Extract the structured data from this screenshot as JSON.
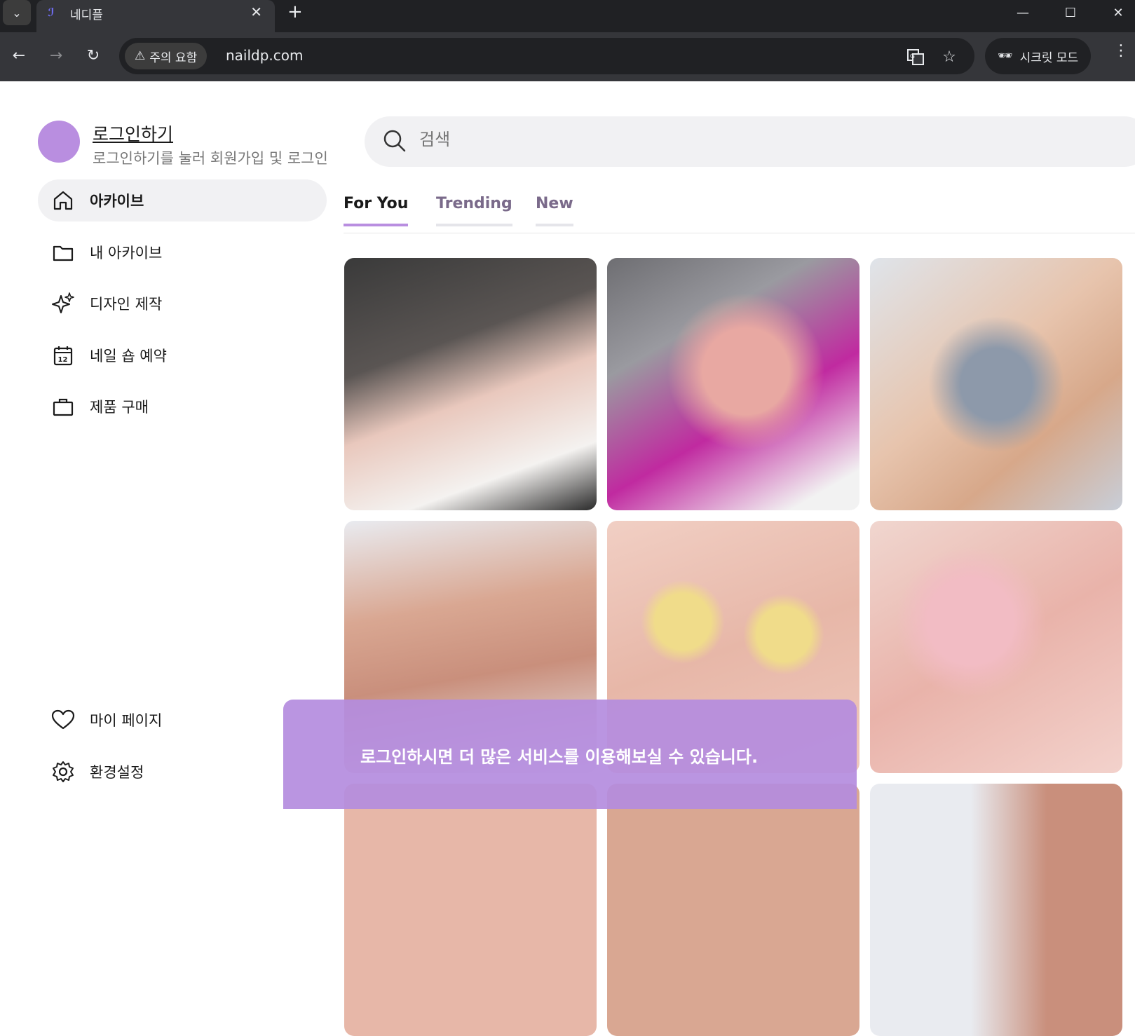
{
  "browser": {
    "tab_title": "네디플",
    "security_chip": "주의 요함",
    "url": "naildp.com",
    "incognito_label": "시크릿 모드"
  },
  "profile": {
    "login_title": "로그인하기",
    "login_subtitle": "로그인하기를 눌러 회원가입 및 로그인"
  },
  "search": {
    "placeholder": "검색"
  },
  "sidebar": {
    "items": [
      {
        "label": "아카이브",
        "icon": "home-icon",
        "active": true
      },
      {
        "label": "내 아카이브",
        "icon": "folder-icon"
      },
      {
        "label": "디자인 제작",
        "icon": "sparkle-icon"
      },
      {
        "label": "네일 숍 예약",
        "icon": "calendar-icon"
      },
      {
        "label": "제품 구매",
        "icon": "shopping-bag-icon"
      }
    ],
    "bottom_items": [
      {
        "label": "마이 페이지",
        "icon": "heart-icon"
      },
      {
        "label": "환경설정",
        "icon": "gear-icon"
      }
    ]
  },
  "feed_tabs": [
    {
      "label": "For You",
      "active": true
    },
    {
      "label": "Trending"
    },
    {
      "label": "New"
    }
  ],
  "toast": {
    "message": "로그인하시면 더 많은 서비스를 이용해보실 수 있습니다."
  },
  "colors": {
    "accent": "#b98ee0",
    "chrome_dark": "#202124",
    "chrome_bar": "#35363a"
  }
}
